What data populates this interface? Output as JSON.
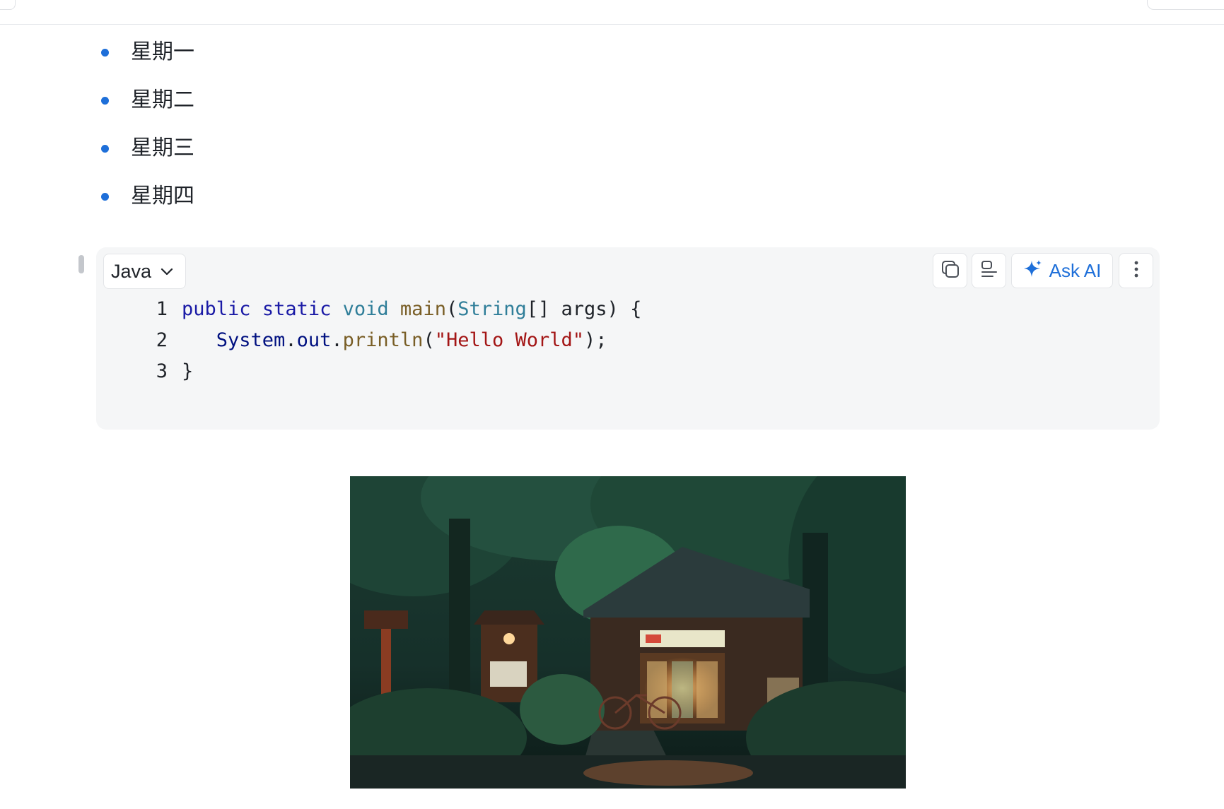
{
  "list": {
    "items": [
      "星期一",
      "星期二",
      "星期三",
      "星期四"
    ]
  },
  "code_block": {
    "language": "Java",
    "actions": {
      "ask_ai_label": "Ask AI"
    },
    "lines": [
      {
        "number": "1",
        "tokens": [
          {
            "text": "public",
            "kind": "kw"
          },
          {
            "text": " ",
            "kind": "plain"
          },
          {
            "text": "static",
            "kind": "kw"
          },
          {
            "text": " ",
            "kind": "plain"
          },
          {
            "text": "void",
            "kind": "type"
          },
          {
            "text": " ",
            "kind": "plain"
          },
          {
            "text": "main",
            "kind": "fn"
          },
          {
            "text": "(",
            "kind": "plain"
          },
          {
            "text": "String",
            "kind": "type"
          },
          {
            "text": "[] args) {",
            "kind": "plain"
          }
        ]
      },
      {
        "number": "2",
        "tokens": [
          {
            "text": "   ",
            "kind": "plain"
          },
          {
            "text": "System",
            "kind": "id"
          },
          {
            "text": ".",
            "kind": "plain"
          },
          {
            "text": "out",
            "kind": "id"
          },
          {
            "text": ".",
            "kind": "plain"
          },
          {
            "text": "println",
            "kind": "fn"
          },
          {
            "text": "(",
            "kind": "plain"
          },
          {
            "text": "\"Hello World\"",
            "kind": "str"
          },
          {
            "text": ");",
            "kind": "plain"
          }
        ]
      },
      {
        "number": "3",
        "tokens": [
          {
            "text": "}",
            "kind": "plain"
          }
        ]
      }
    ]
  },
  "colors": {
    "accent": "#1e6fd9",
    "code_background": "#f5f6f7",
    "keyword": "#1a1aa6",
    "type": "#2f7e99",
    "function": "#795e26",
    "string": "#a31515"
  },
  "icons": {
    "copy": "copy-icon",
    "format": "align-left-icon",
    "ask_ai": "sparkle-icon",
    "more": "more-vertical-icon",
    "language_dropdown": "chevron-down-icon"
  }
}
